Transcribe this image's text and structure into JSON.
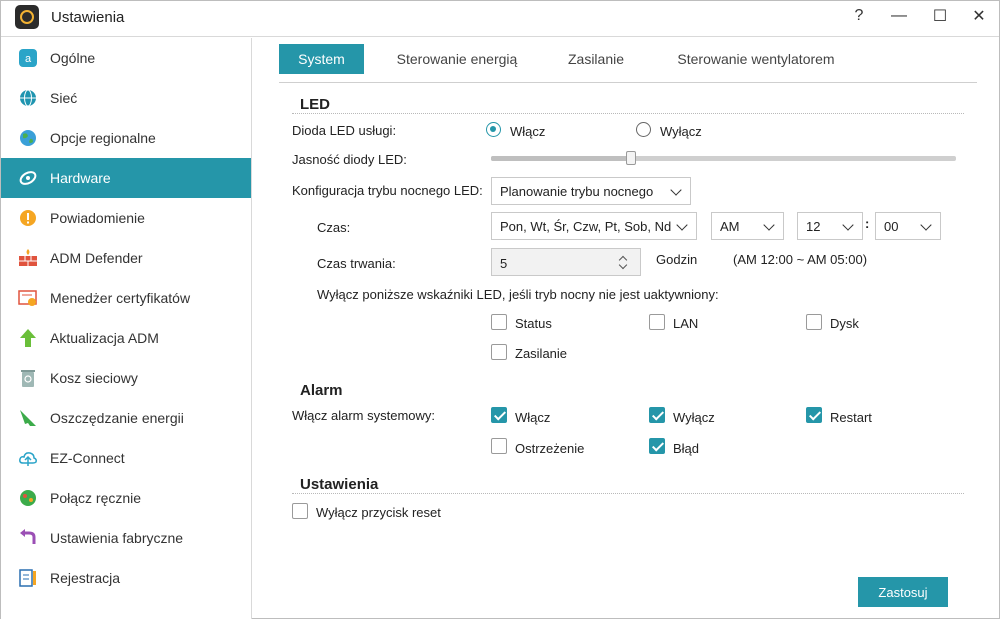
{
  "window": {
    "title": "Ustawienia",
    "help_glyph": "?",
    "minimize_glyph": "—",
    "maximize_glyph": "☐",
    "close_glyph": "✕"
  },
  "colors": {
    "accent": "#2596a9"
  },
  "sidebar": {
    "items": [
      {
        "label": "Ogólne",
        "icon": "general-icon",
        "active": false
      },
      {
        "label": "Sieć",
        "icon": "network-globe-icon",
        "active": false
      },
      {
        "label": "Opcje regionalne",
        "icon": "regional-globe-icon",
        "active": false
      },
      {
        "label": "Hardware",
        "icon": "hardware-icon",
        "active": true
      },
      {
        "label": "Powiadomienie",
        "icon": "notification-icon",
        "active": false
      },
      {
        "label": "ADM Defender",
        "icon": "firewall-icon",
        "active": false
      },
      {
        "label": "Menedżer certyfikatów",
        "icon": "certificate-icon",
        "active": false
      },
      {
        "label": "Aktualizacja ADM",
        "icon": "update-arrow-icon",
        "active": false
      },
      {
        "label": "Kosz sieciowy",
        "icon": "recycle-bin-icon",
        "active": false
      },
      {
        "label": "Oszczędzanie energii",
        "icon": "energy-saving-icon",
        "active": false
      },
      {
        "label": "EZ-Connect",
        "icon": "cloud-connect-icon",
        "active": false
      },
      {
        "label": "Połącz ręcznie",
        "icon": "manual-connect-icon",
        "active": false
      },
      {
        "label": "Ustawienia fabryczne",
        "icon": "factory-reset-icon",
        "active": false
      },
      {
        "label": "Rejestracja",
        "icon": "registration-icon",
        "active": false
      }
    ]
  },
  "tabs": [
    {
      "label": "System",
      "active": true
    },
    {
      "label": "Sterowanie energią",
      "active": false
    },
    {
      "label": "Zasilanie",
      "active": false
    },
    {
      "label": "Sterowanie wentylatorem",
      "active": false
    }
  ],
  "led": {
    "title": "LED",
    "service_led_label": "Dioda LED usługi:",
    "on_label": "Włącz",
    "off_label": "Wyłącz",
    "service_led_value": "on",
    "brightness_label": "Jasność diody LED:",
    "brightness_fraction": 0.3,
    "night_mode_label": "Konfiguracja trybu nocnego LED:",
    "night_mode_value": "Planowanie trybu nocnego",
    "time_label": "Czas:",
    "days_value": "Pon, Wt, Śr, Czw, Pt, Sob, Nd",
    "ampm_value": "AM",
    "hour_value": "12",
    "time_separator": ":",
    "minute_value": "00",
    "duration_label": "Czas trwania:",
    "duration_value": "5",
    "duration_unit": "Godzin",
    "duration_range": "(AM 12:00 ~ AM 05:00)",
    "disable_note": "Wyłącz poniższe wskaźniki LED, jeśli tryb nocny nie jest uaktywniony:",
    "indicators": [
      {
        "label": "Status",
        "checked": false
      },
      {
        "label": "LAN",
        "checked": false
      },
      {
        "label": "Dysk",
        "checked": false
      },
      {
        "label": "Zasilanie",
        "checked": false
      }
    ]
  },
  "alarm": {
    "title": "Alarm",
    "system_alarm_label": "Włącz alarm systemowy:",
    "options": [
      {
        "label": "Włącz",
        "checked": true
      },
      {
        "label": "Wyłącz",
        "checked": true
      },
      {
        "label": "Restart",
        "checked": true
      },
      {
        "label": "Ostrzeżenie",
        "checked": false
      },
      {
        "label": "Błąd",
        "checked": true
      }
    ]
  },
  "settings": {
    "title": "Ustawienia",
    "reset_label": "Wyłącz przycisk reset",
    "reset_checked": false
  },
  "apply_label": "Zastosuj"
}
